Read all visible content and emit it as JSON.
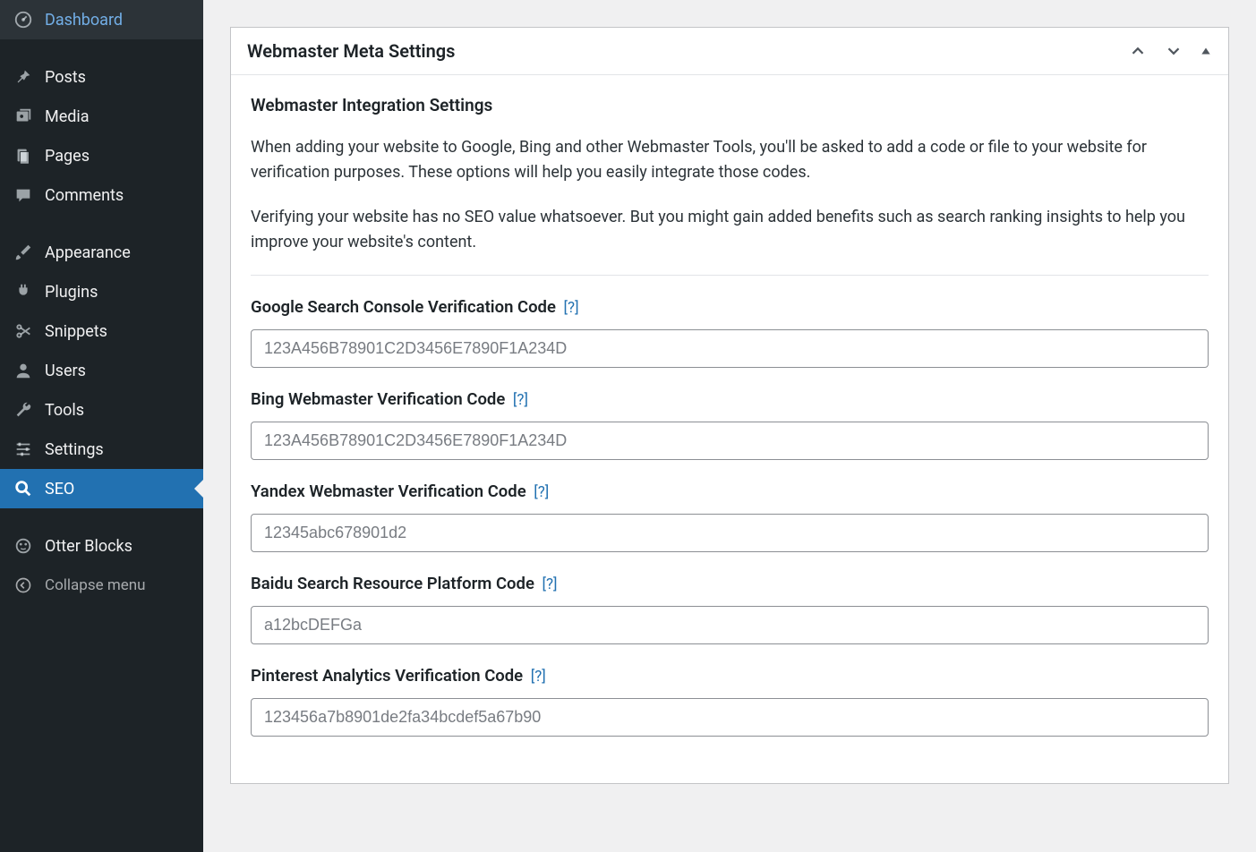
{
  "sidebar": {
    "items": [
      {
        "label": "Dashboard",
        "icon": "dashboard"
      },
      {
        "label": "Posts",
        "icon": "pin"
      },
      {
        "label": "Media",
        "icon": "media"
      },
      {
        "label": "Pages",
        "icon": "pages"
      },
      {
        "label": "Comments",
        "icon": "comment"
      },
      {
        "label": "Appearance",
        "icon": "brush"
      },
      {
        "label": "Plugins",
        "icon": "plug"
      },
      {
        "label": "Snippets",
        "icon": "scissors"
      },
      {
        "label": "Users",
        "icon": "user"
      },
      {
        "label": "Tools",
        "icon": "wrench"
      },
      {
        "label": "Settings",
        "icon": "sliders"
      },
      {
        "label": "SEO",
        "icon": "search"
      },
      {
        "label": "Otter Blocks",
        "icon": "otter"
      },
      {
        "label": "Collapse menu",
        "icon": "collapse"
      }
    ]
  },
  "panel": {
    "title": "Webmaster Meta Settings",
    "subheading": "Webmaster Integration Settings",
    "paragraph1": "When adding your website to Google, Bing and other Webmaster Tools, you'll be asked to add a code or file to your website for verification purposes. These options will help you easily integrate those codes.",
    "paragraph2": "Verifying your website has no SEO value whatsoever. But you might gain added benefits such as search ranking insights to help you improve your website's content.",
    "help_text": "[?]",
    "fields": [
      {
        "label": "Google Search Console Verification Code",
        "placeholder": "123A456B78901C2D3456E7890F1A234D",
        "value": ""
      },
      {
        "label": "Bing Webmaster Verification Code",
        "placeholder": "123A456B78901C2D3456E7890F1A234D",
        "value": ""
      },
      {
        "label": "Yandex Webmaster Verification Code",
        "placeholder": "12345abc678901d2",
        "value": ""
      },
      {
        "label": "Baidu Search Resource Platform Code",
        "placeholder": "a12bcDEFGa",
        "value": ""
      },
      {
        "label": "Pinterest Analytics Verification Code",
        "placeholder": "123456a7b8901de2fa34bcdef5a67b90",
        "value": ""
      }
    ]
  }
}
